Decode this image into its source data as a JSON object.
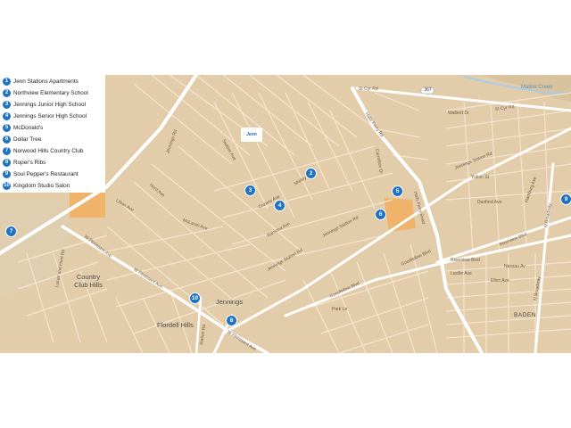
{
  "legend": [
    {
      "num": "1",
      "label": "Jenn Stations Apartments"
    },
    {
      "num": "2",
      "label": "Northview Elementary School"
    },
    {
      "num": "3",
      "label": "Jennings Junior High School"
    },
    {
      "num": "4",
      "label": "Jennings Senior High School"
    },
    {
      "num": "5",
      "label": "McDonald's"
    },
    {
      "num": "6",
      "label": "Dollar Tree"
    },
    {
      "num": "7",
      "label": "Norwood Hills Country Club"
    },
    {
      "num": "8",
      "label": "Roper's Ribs"
    },
    {
      "num": "9",
      "label": "Soul Pepper's Restaurant"
    },
    {
      "num": "10",
      "label": "Kingdom Studio Salon"
    }
  ],
  "places": {
    "country_club_hills": "Country Club Hills",
    "flordell_hills": "Flordell Hills",
    "jennings": "Jennings",
    "baden": "BADEN",
    "maline_creek": "Maline Creek"
  },
  "streets": {
    "st_cyr_rd": "St Cyr Rd",
    "st_cyr_rd_2": "St Cyr Rd",
    "halls_ferry_rd": "Halls Ferry Rd",
    "halls_ferry_rd_2": "Halls Ferry Road",
    "jennings_station_rd": "Jennings Station Rd",
    "jennings_station_rd_2": "Jennings Station Rd",
    "jennings_station_rd_3": "Jennings Station Rd",
    "w_florissant_ave": "W Florissant Ave",
    "w_florissant_ave_2": "W Florissant Ave",
    "w_florissant_ave_3": "W Florissant Ave",
    "goodfellow_blvd": "Goodfellow Blvd",
    "goodfellow_blvd_2": "Goodfellow Blvd",
    "riverview_blvd": "Riverview Blvd",
    "riverview_blvd_2": "Riverview Blvd",
    "n_broadway": "N Broadway",
    "n_broadway_2": "N Broadway",
    "lucas_hunt": "Lucas and Hunt Rd",
    "station_rd": "Station Rd",
    "cozens_ave": "Cozens Ave",
    "mclaran_ave": "McLaran Ave",
    "lillian_ave": "Lillian Ave",
    "hord_ave": "Hord Ave",
    "jennings_rd": "Jennings Rd",
    "switzer_ave": "Switzer Ave",
    "shirley_ave": "Shirley Ave",
    "nassau_av": "Nassau Av",
    "ellen_ave": "Ellen Ave",
    "lucille_ave": "Lucille Ave",
    "dunford_ave": "Dunford Ave",
    "yukon_st": "Yukon St",
    "walbert_dr": "Walbert Dr",
    "carrollton": "Carrollton Dr",
    "hamburg_ave": "Hamburg Ave",
    "ramona_ave": "Ramona Ave",
    "pl_dr": "Park Ln"
  },
  "route_badge": "367",
  "logo_text": "Jenn"
}
